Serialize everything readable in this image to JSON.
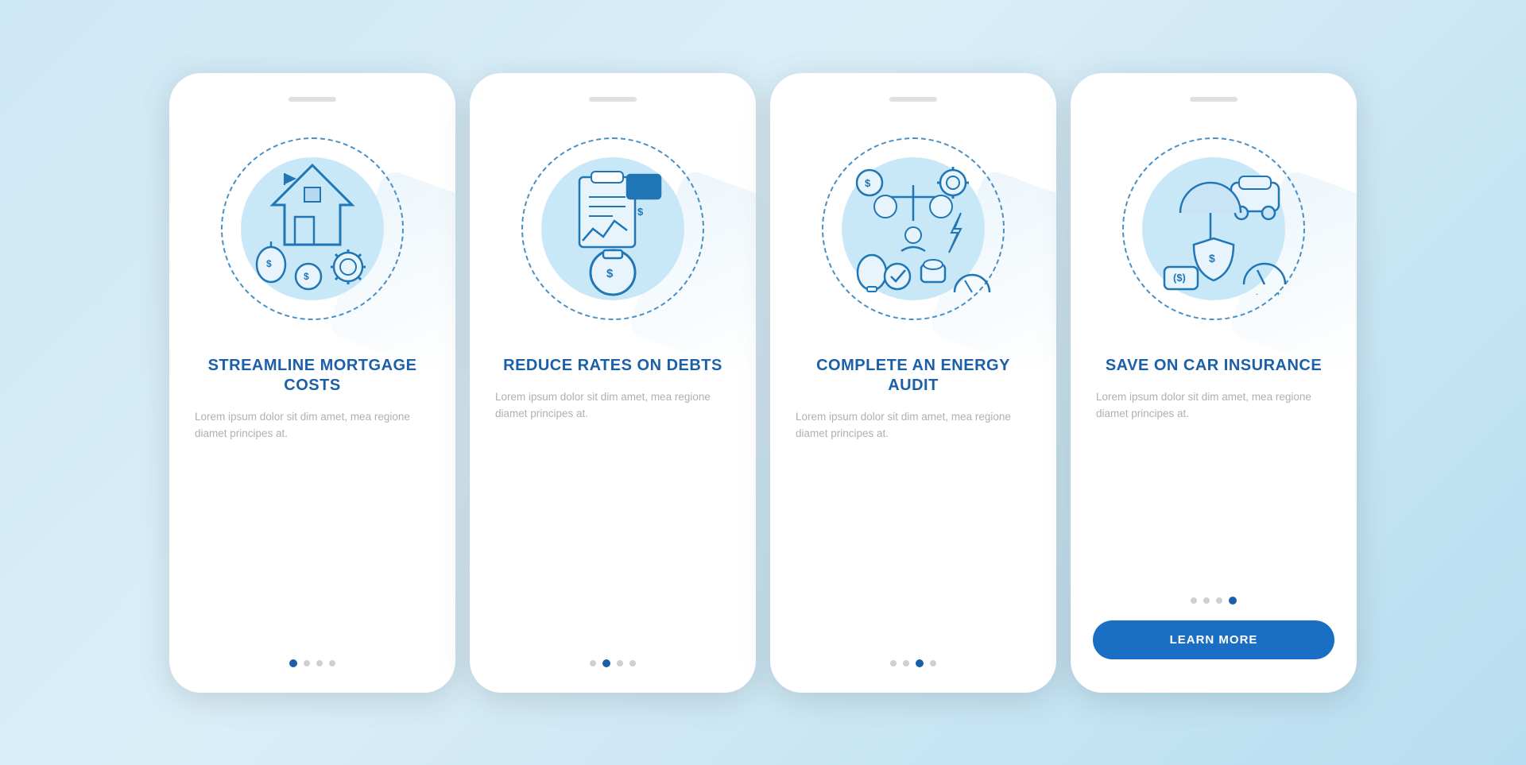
{
  "page": {
    "background": "#cde8f5"
  },
  "cards": [
    {
      "id": "card-1",
      "title": "STREAMLINE\nMORTGAGE COSTS",
      "description": "Lorem ipsum dolor sit dim amet, mea regione diamet principes at.",
      "dots": [
        true,
        false,
        false,
        false
      ],
      "has_button": false,
      "active_dot": 0
    },
    {
      "id": "card-2",
      "title": "REDUCE RATES\nON DEBTS",
      "description": "Lorem ipsum dolor sit dim amet, mea regione diamet principes at.",
      "dots": [
        false,
        true,
        false,
        false
      ],
      "has_button": false,
      "active_dot": 1
    },
    {
      "id": "card-3",
      "title": "COMPLETE AN\nENERGY AUDIT",
      "description": "Lorem ipsum dolor sit dim amet, mea regione diamet principes at.",
      "dots": [
        false,
        false,
        true,
        false
      ],
      "has_button": false,
      "active_dot": 2
    },
    {
      "id": "card-4",
      "title": "SAVE ON CAR\nINSURANCE",
      "description": "Lorem ipsum dolor sit dim amet, mea regione diamet principes at.",
      "dots": [
        false,
        false,
        false,
        true
      ],
      "has_button": true,
      "active_dot": 3,
      "button_label": "LEARN MORE"
    }
  ]
}
